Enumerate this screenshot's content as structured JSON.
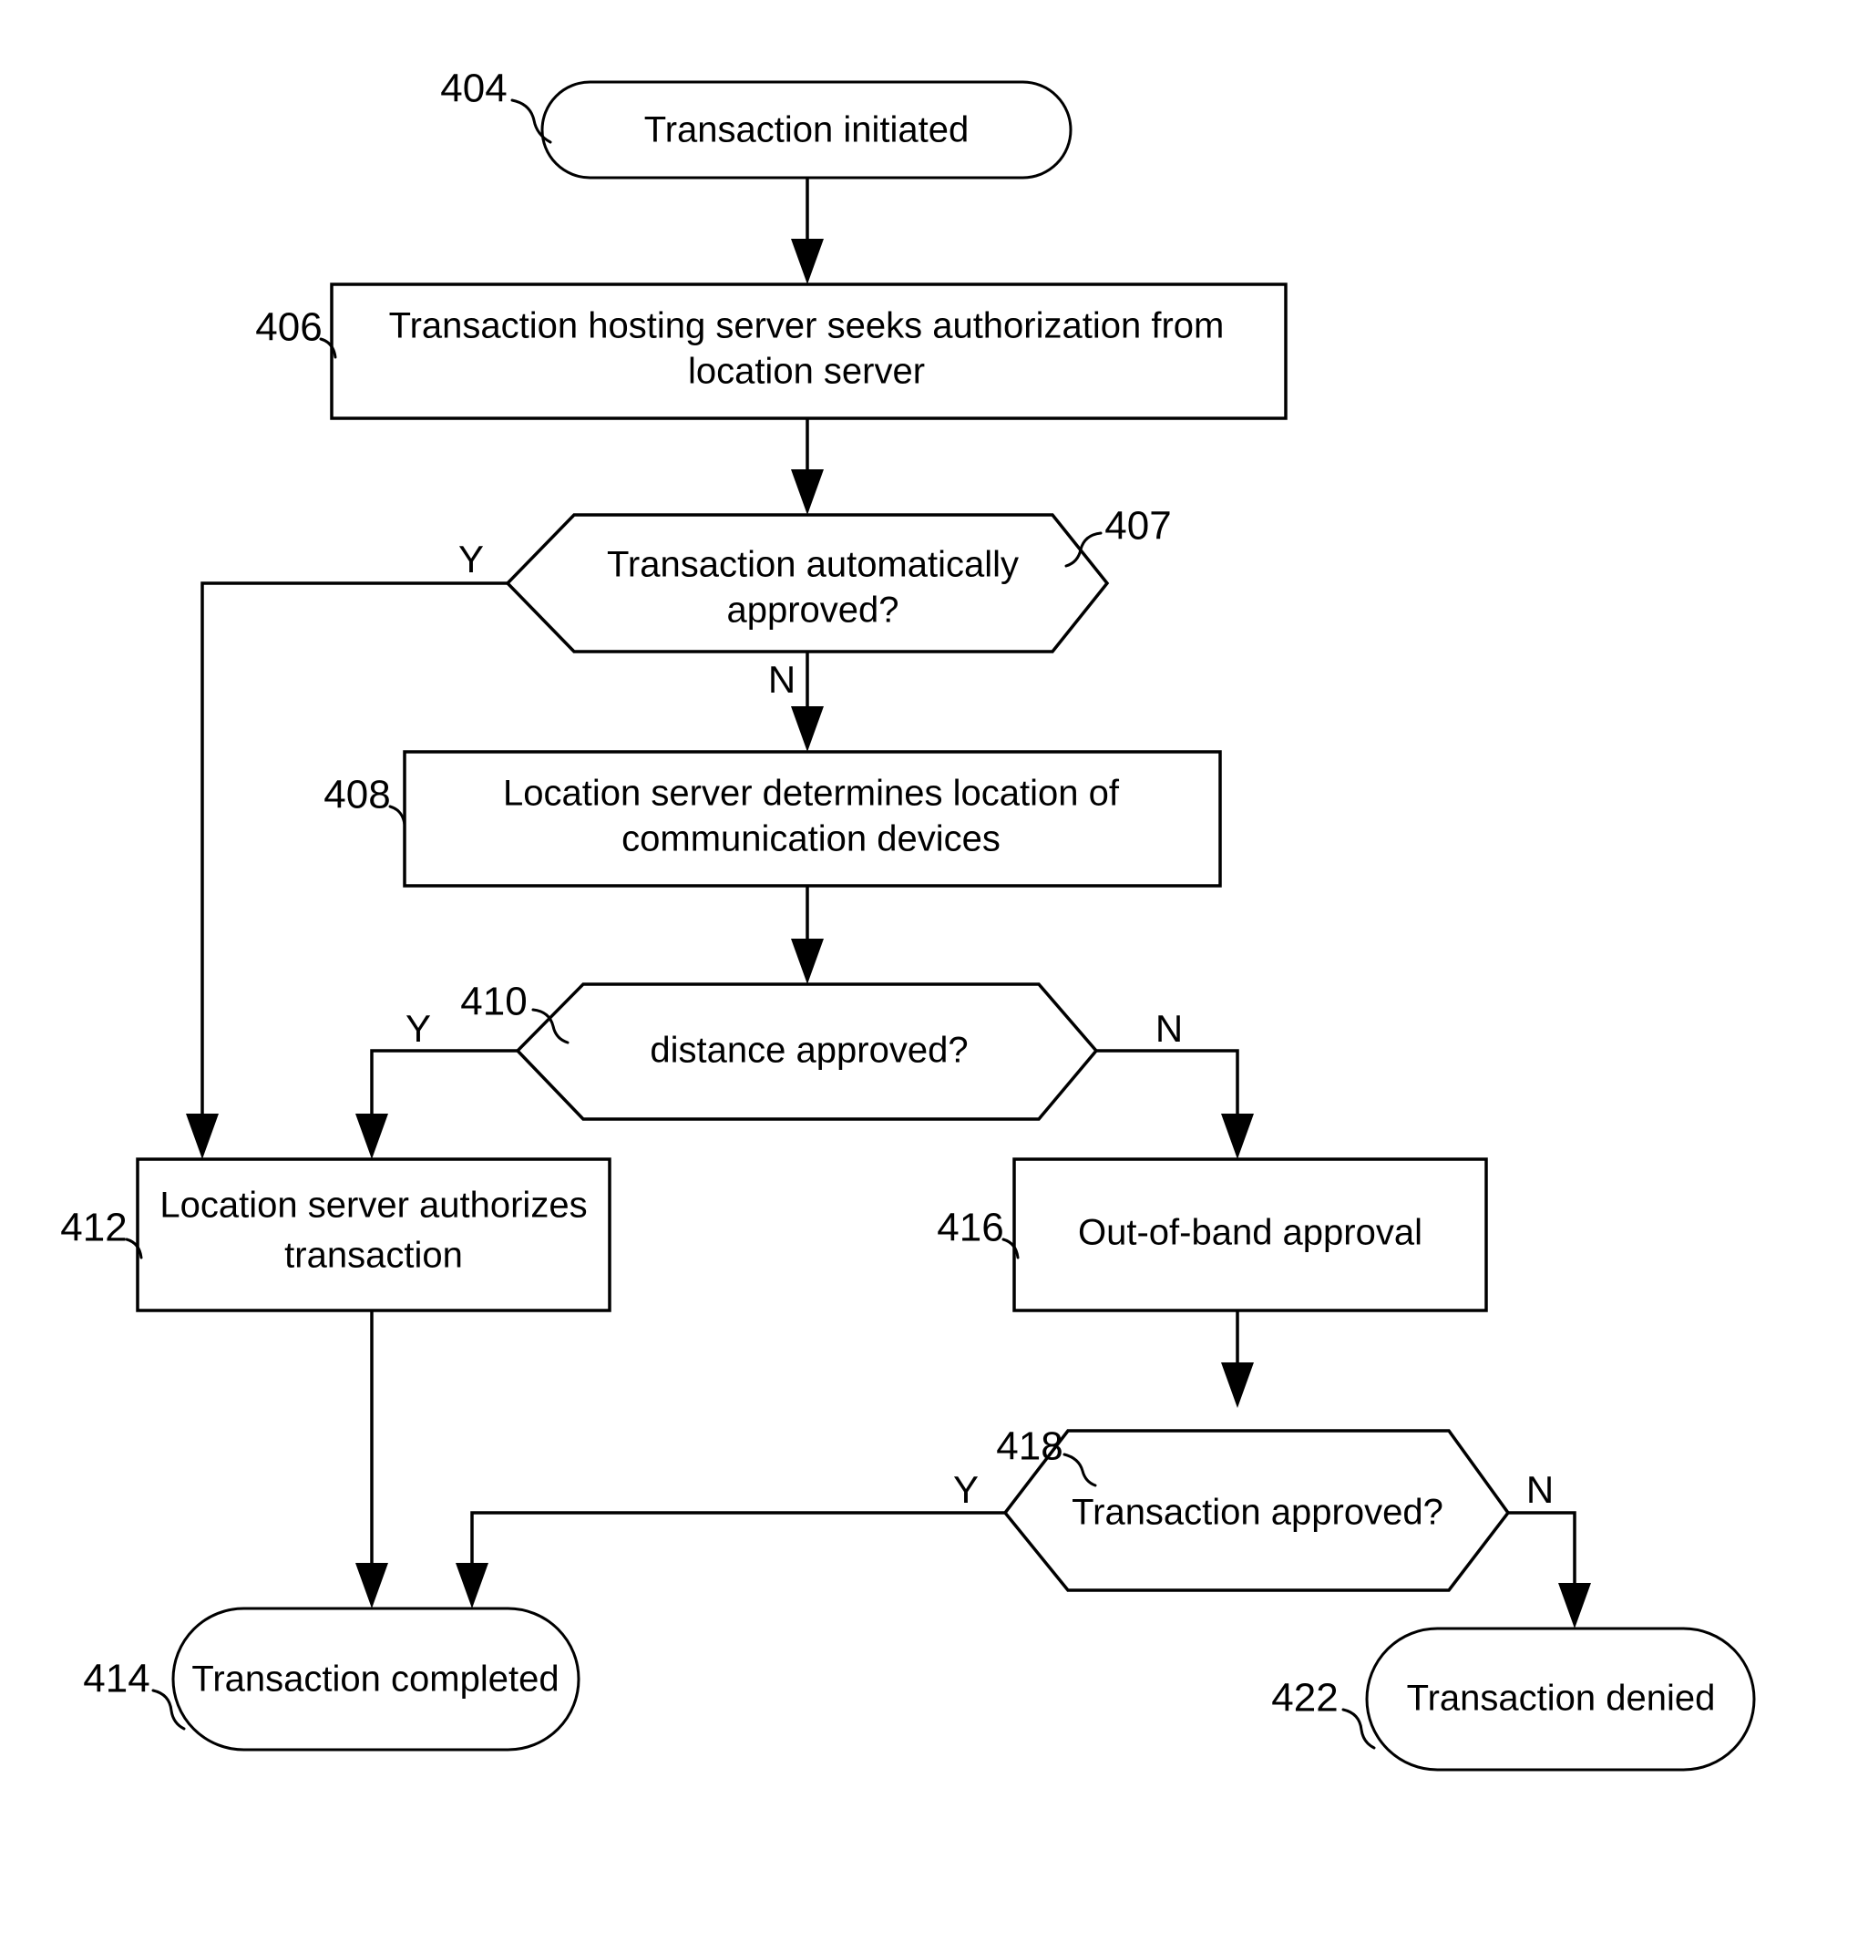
{
  "figure": {
    "type": "flowchart",
    "background": "#ffffff",
    "stroke_color": "#000000",
    "nodes": [
      {
        "id": "n404",
        "ref": "404",
        "shape": "stadium",
        "lines": [
          "Transaction initiated"
        ]
      },
      {
        "id": "n406",
        "ref": "406",
        "shape": "rectangle",
        "lines": [
          "Transaction hosting server seeks authorization from",
          "location server"
        ]
      },
      {
        "id": "n407",
        "ref": "407",
        "shape": "hexagon",
        "lines": [
          "Transaction automatically",
          "approved?"
        ]
      },
      {
        "id": "n408",
        "ref": "408",
        "shape": "rectangle",
        "lines": [
          "Location server determines location of",
          "communication devices"
        ]
      },
      {
        "id": "n410",
        "ref": "410",
        "shape": "hexagon",
        "lines": [
          "distance approved?"
        ]
      },
      {
        "id": "n412",
        "ref": "412",
        "shape": "rectangle",
        "lines": [
          "Location server authorizes",
          "transaction"
        ]
      },
      {
        "id": "n416",
        "ref": "416",
        "shape": "rectangle",
        "lines": [
          "Out-of-band approval"
        ]
      },
      {
        "id": "n418",
        "ref": "418",
        "shape": "hexagon",
        "lines": [
          "Transaction approved?"
        ]
      },
      {
        "id": "n414",
        "ref": "414",
        "shape": "stadium",
        "lines": [
          "Transaction completed"
        ]
      },
      {
        "id": "n422",
        "ref": "422",
        "shape": "stadium",
        "lines": [
          "Transaction denied"
        ]
      }
    ],
    "branch_labels": {
      "n407_yes": "Y",
      "n407_no": "N",
      "n410_yes": "Y",
      "n410_no": "N",
      "n418_yes": "Y",
      "n418_no": "N"
    },
    "edges": [
      {
        "from": "n404",
        "to": "n406",
        "label": ""
      },
      {
        "from": "n406",
        "to": "n407",
        "label": ""
      },
      {
        "from": "n407",
        "to": "n412",
        "label": "Y"
      },
      {
        "from": "n407",
        "to": "n408",
        "label": "N"
      },
      {
        "from": "n408",
        "to": "n410",
        "label": ""
      },
      {
        "from": "n410",
        "to": "n412",
        "label": "Y"
      },
      {
        "from": "n410",
        "to": "n416",
        "label": "N"
      },
      {
        "from": "n412",
        "to": "n414",
        "label": ""
      },
      {
        "from": "n416",
        "to": "n418",
        "label": ""
      },
      {
        "from": "n418",
        "to": "n414",
        "label": "Y"
      },
      {
        "from": "n418",
        "to": "n422",
        "label": "N"
      }
    ]
  }
}
